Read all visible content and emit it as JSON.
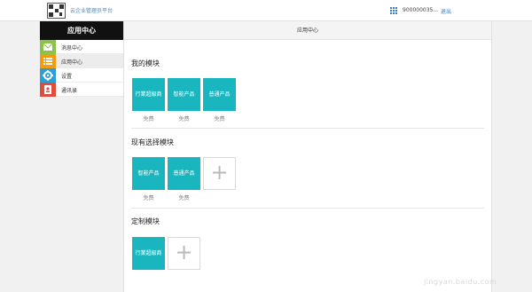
{
  "topbar": {
    "brand": "云企业管理员平台",
    "user": "900000035...",
    "logout": "退出"
  },
  "sidebar": {
    "title": "应用中心",
    "items": [
      {
        "label": "消息中心",
        "icon": "mail-icon",
        "color": "#8bc34a"
      },
      {
        "label": "应用中心",
        "icon": "list-icon",
        "color": "#f39c12"
      },
      {
        "label": "设置",
        "icon": "gear-icon",
        "color": "#2d9fd8"
      },
      {
        "label": "通讯录",
        "icon": "contacts-icon",
        "color": "#e04d3d"
      }
    ]
  },
  "main": {
    "header": "应用中心",
    "sections": [
      {
        "title": "我的模块",
        "tiles": [
          {
            "label": "行業超級商",
            "caption": "免费"
          },
          {
            "label": "智能产品",
            "caption": "免费"
          },
          {
            "label": "普通产品",
            "caption": "免费"
          }
        ]
      },
      {
        "title": "现有选择模块",
        "tiles": [
          {
            "label": "智能产品",
            "caption": "免费"
          },
          {
            "label": "普通产品",
            "caption": "免费"
          }
        ],
        "add": "+"
      },
      {
        "title": "定制模块",
        "tiles": [
          {
            "label": "行業超級商"
          }
        ],
        "add": "+"
      }
    ]
  },
  "watermark": "jingyan.baidu.com",
  "colors": {
    "tile": "#19b6c0",
    "sidebar_title_bg": "#111111"
  }
}
